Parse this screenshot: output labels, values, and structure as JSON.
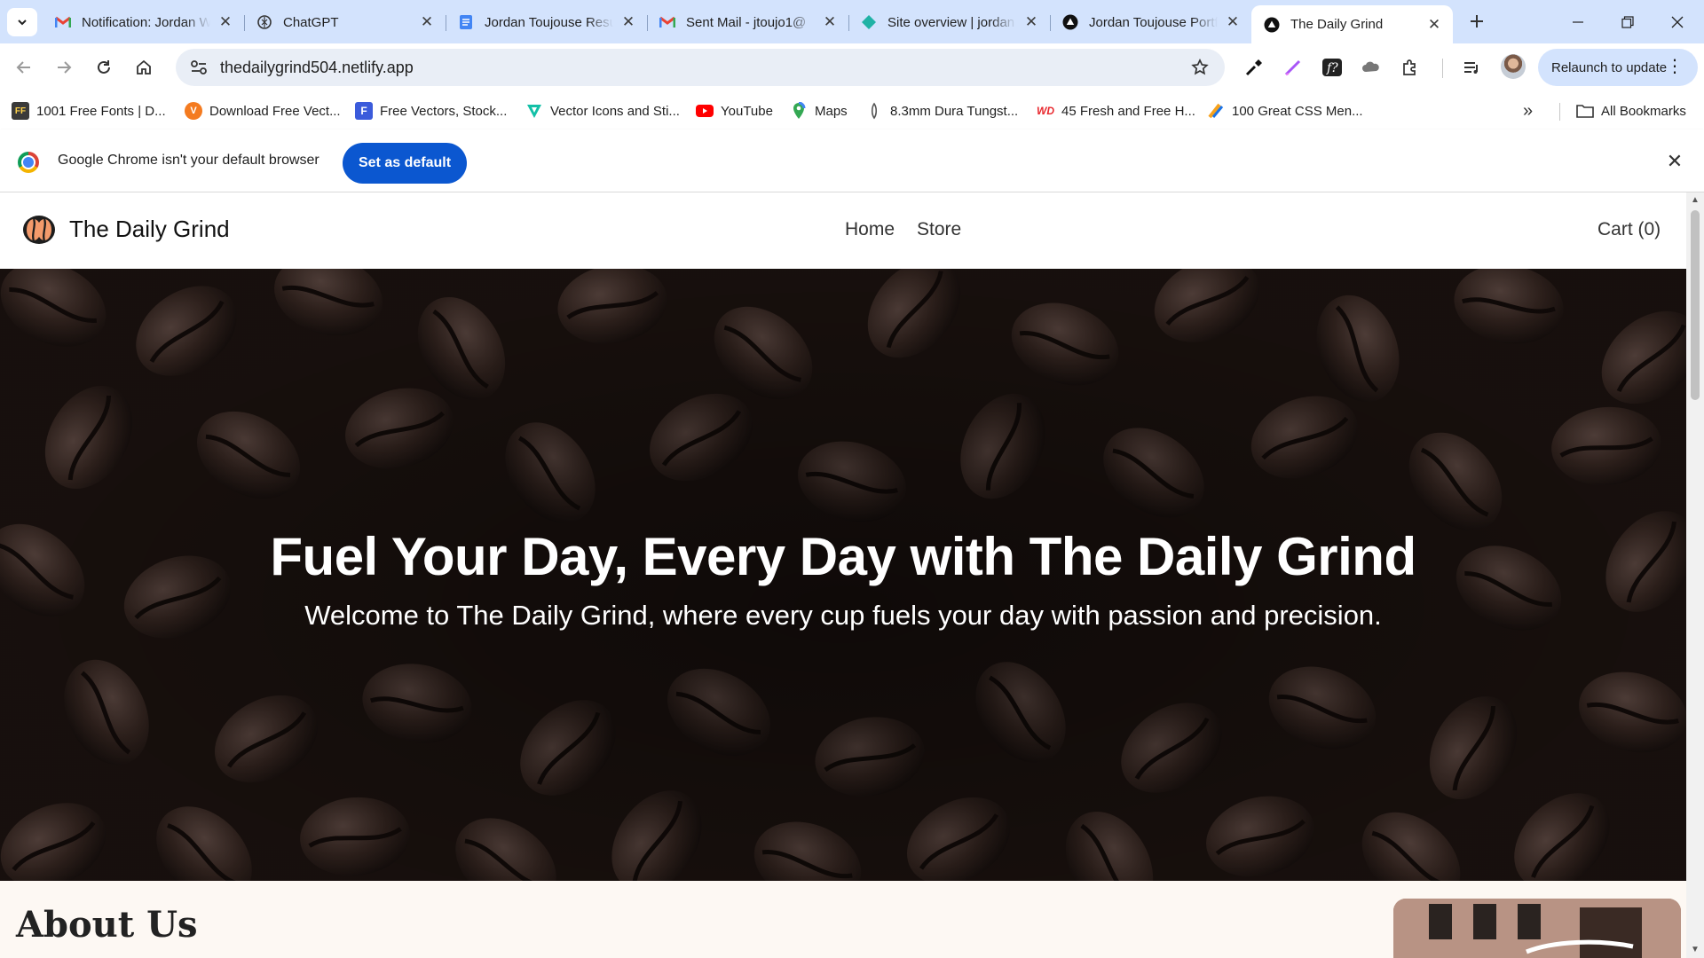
{
  "browser": {
    "tabs": [
      {
        "title": "Notification: Jordan W",
        "icon": "gmail-icon",
        "active": false
      },
      {
        "title": "ChatGPT",
        "icon": "chatgpt-icon",
        "active": false
      },
      {
        "title": "Jordan Toujouse Resume",
        "icon": "docs-icon",
        "active": false
      },
      {
        "title": "Sent Mail - jtoujo1@",
        "icon": "gmail-icon",
        "active": false
      },
      {
        "title": "Site overview | jordan",
        "icon": "netlify-icon",
        "active": false
      },
      {
        "title": "Jordan Toujouse Portfolio",
        "icon": "vercel-icon",
        "active": false
      },
      {
        "title": "The Daily Grind",
        "icon": "vercel-icon",
        "active": true
      }
    ],
    "url": "thedailygrind504.netlify.app",
    "relaunch_label": "Relaunch to update",
    "bookmarks": [
      {
        "label": "1001 Free Fonts | D...",
        "icon": "fonts-icon",
        "color": "#3a3a3a"
      },
      {
        "label": "Download Free Vect...",
        "icon": "vecteezy-icon",
        "color": "#f47b20"
      },
      {
        "label": "Free Vectors, Stock...",
        "icon": "freepik-icon",
        "color": "#3b5bdb"
      },
      {
        "label": "Vector Icons and Sti...",
        "icon": "flaticon-icon",
        "color": "#13c0a7"
      },
      {
        "label": "YouTube",
        "icon": "youtube-icon",
        "color": "#ff0000"
      },
      {
        "label": "Maps",
        "icon": "maps-icon",
        "color": "#34a853"
      },
      {
        "label": "8.3mm Dura Tungst...",
        "icon": "ring-icon",
        "color": "#555555"
      },
      {
        "label": "45 Fresh and Free H...",
        "icon": "wd-icon",
        "color": "#e8262c"
      },
      {
        "label": "100 Great CSS Men...",
        "icon": "css-icon",
        "color": "#f7a21c"
      }
    ],
    "all_bookmarks_label": "All Bookmarks",
    "infobar": {
      "message": "Google Chrome isn't your default browser",
      "button": "Set as default"
    }
  },
  "site": {
    "name": "The Daily Grind",
    "nav": [
      "Home",
      "Store"
    ],
    "cart": "Cart (0)",
    "hero_title": "Fuel Your Day, Every Day with The Daily Grind",
    "hero_subtitle": "Welcome to The Daily Grind, where every cup fuels your day with passion and precision.",
    "about_title": "About Us"
  },
  "colors": {
    "tabstrip": "#d3e3fd",
    "accent": "#0b57d0",
    "hero_dark": "#1a1210"
  }
}
